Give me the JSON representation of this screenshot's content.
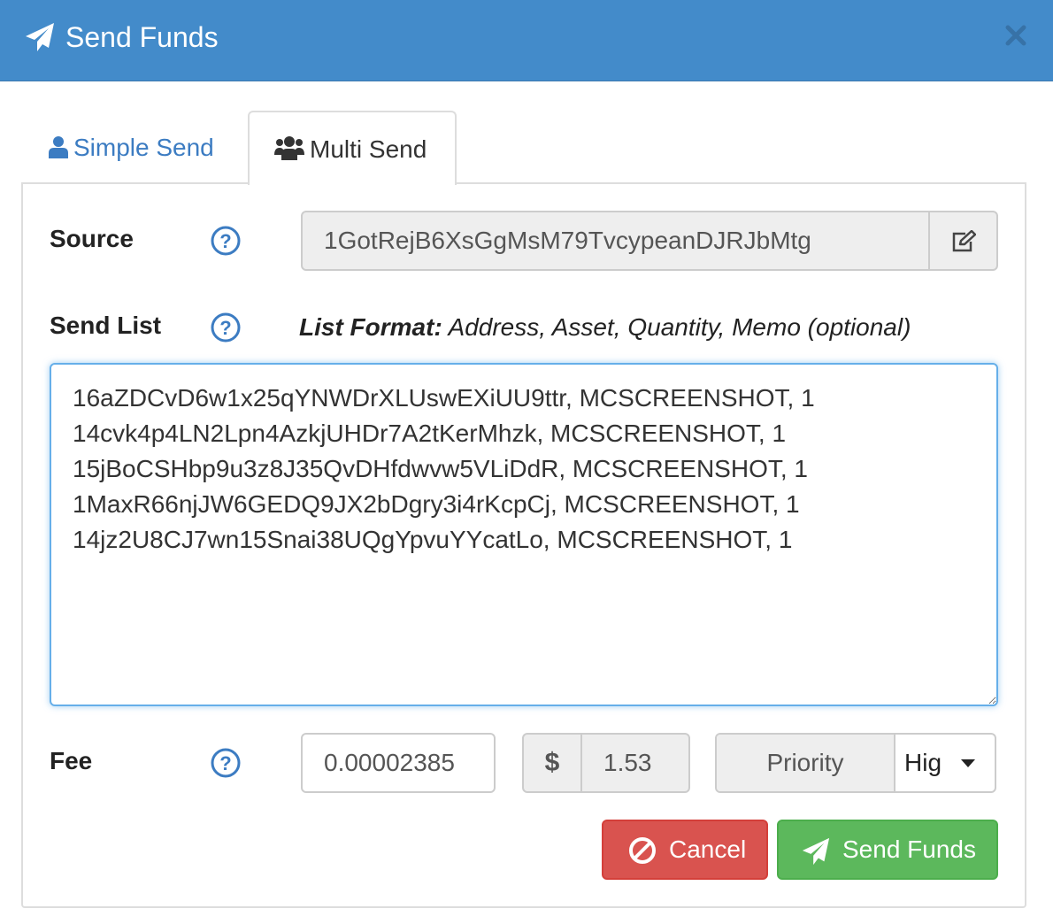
{
  "header": {
    "title": "Send Funds",
    "icon": "paper-plane-icon",
    "close_icon": "close-icon",
    "background": "#438bca"
  },
  "tabs": [
    {
      "label": "Simple Send",
      "icon": "user-icon",
      "active": false
    },
    {
      "label": "Multi Send",
      "icon": "users-icon",
      "active": true
    }
  ],
  "source": {
    "label": "Source",
    "value": "1GotRejB6XsGgMsM79TvcypeanDJRJbMtg",
    "edit_icon": "edit-icon"
  },
  "send_list": {
    "label": "Send List",
    "format_label": "List Format:",
    "format_text": " Address, Asset, Quantity, Memo (optional)",
    "value": "16aZDCvD6w1x25qYNWDrXLUswEXiUU9ttr, MCSCREENSHOT, 1\n14cvk4p4LN2Lpn4AzkjUHDr7A2tKerMhzk, MCSCREENSHOT, 1\n15jBoCSHbp9u3z8J35QvDHfdwvw5VLiDdR, MCSCREENSHOT, 1\n1MaxR66njJW6GEDQ9JX2bDgry3i4rKcpCj, MCSCREENSHOT, 1\n14jz2U8CJ7wn15Snai38UQgYpvuYYcatLo, MCSCREENSHOT, 1"
  },
  "fee": {
    "label": "Fee",
    "value": "0.00002385",
    "usd_symbol": "$",
    "usd_value": "1.53",
    "priority_label": "Priority",
    "priority_value": "Hig"
  },
  "buttons": {
    "cancel": "Cancel",
    "send": "Send Funds"
  },
  "colors": {
    "accent": "#438bca",
    "link": "#3c7cc2",
    "cancel": "#d9534f",
    "send": "#5cb85c"
  }
}
